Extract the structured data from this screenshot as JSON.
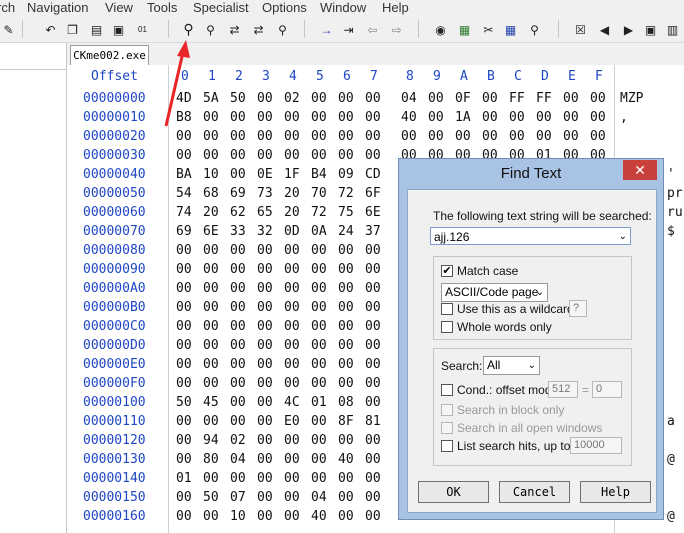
{
  "menu": [
    "rch",
    "Navigation",
    "View",
    "Tools",
    "Specialist",
    "Options",
    "Window",
    "Help"
  ],
  "tab": {
    "label": "CKme002.exe"
  },
  "header": {
    "offset_label": "Offset",
    "cols": [
      "0",
      "1",
      "2",
      "3",
      "4",
      "5",
      "6",
      "7",
      "8",
      "9",
      "A",
      "B",
      "C",
      "D",
      "E",
      "F"
    ]
  },
  "rows": [
    {
      "offset": "00000000",
      "bytes": [
        "4D",
        "5A",
        "50",
        "00",
        "02",
        "00",
        "00",
        "00",
        "04",
        "00",
        "0F",
        "00",
        "FF",
        "FF",
        "00",
        "00"
      ],
      "text": "MZP"
    },
    {
      "offset": "00000010",
      "bytes": [
        "B8",
        "00",
        "00",
        "00",
        "00",
        "00",
        "00",
        "00",
        "40",
        "00",
        "1A",
        "00",
        "00",
        "00",
        "00",
        "00"
      ],
      "text": ","
    },
    {
      "offset": "00000020",
      "bytes": [
        "00",
        "00",
        "00",
        "00",
        "00",
        "00",
        "00",
        "00",
        "00",
        "00",
        "00",
        "00",
        "00",
        "00",
        "00",
        "00"
      ],
      "text": ""
    },
    {
      "offset": "00000030",
      "bytes": [
        "00",
        "00",
        "00",
        "00",
        "00",
        "00",
        "00",
        "00",
        "00",
        "00",
        "00",
        "00",
        "00",
        "01",
        "00",
        "00"
      ],
      "text": ""
    },
    {
      "offset": "00000040",
      "bytes": [
        "BA",
        "10",
        "00",
        "0E",
        "1F",
        "B4",
        "09",
        "CD",
        "",
        "",
        "",
        "",
        "",
        "",
        "",
        ""
      ],
      "text": "'"
    },
    {
      "offset": "00000050",
      "bytes": [
        "54",
        "68",
        "69",
        "73",
        "20",
        "70",
        "72",
        "6F",
        "",
        "",
        "",
        "",
        "",
        "",
        "",
        ""
      ],
      "text": "pr"
    },
    {
      "offset": "00000060",
      "bytes": [
        "74",
        "20",
        "62",
        "65",
        "20",
        "72",
        "75",
        "6E",
        "",
        "",
        "",
        "",
        "",
        "",
        "",
        ""
      ],
      "text": "ru"
    },
    {
      "offset": "00000070",
      "bytes": [
        "69",
        "6E",
        "33",
        "32",
        "0D",
        "0A",
        "24",
        "37",
        "",
        "",
        "",
        "",
        "",
        "",
        "",
        ""
      ],
      "text": "$"
    },
    {
      "offset": "00000080",
      "bytes": [
        "00",
        "00",
        "00",
        "00",
        "00",
        "00",
        "00",
        "00",
        "",
        "",
        "",
        "",
        "",
        "",
        "",
        ""
      ],
      "text": ""
    },
    {
      "offset": "00000090",
      "bytes": [
        "00",
        "00",
        "00",
        "00",
        "00",
        "00",
        "00",
        "00",
        "",
        "",
        "",
        "",
        "",
        "",
        "",
        ""
      ],
      "text": ""
    },
    {
      "offset": "000000A0",
      "bytes": [
        "00",
        "00",
        "00",
        "00",
        "00",
        "00",
        "00",
        "00",
        "",
        "",
        "",
        "",
        "",
        "",
        "",
        ""
      ],
      "text": ""
    },
    {
      "offset": "000000B0",
      "bytes": [
        "00",
        "00",
        "00",
        "00",
        "00",
        "00",
        "00",
        "00",
        "",
        "",
        "",
        "",
        "",
        "",
        "",
        ""
      ],
      "text": ""
    },
    {
      "offset": "000000C0",
      "bytes": [
        "00",
        "00",
        "00",
        "00",
        "00",
        "00",
        "00",
        "00",
        "",
        "",
        "",
        "",
        "",
        "",
        "",
        ""
      ],
      "text": ""
    },
    {
      "offset": "000000D0",
      "bytes": [
        "00",
        "00",
        "00",
        "00",
        "00",
        "00",
        "00",
        "00",
        "",
        "",
        "",
        "",
        "",
        "",
        "",
        ""
      ],
      "text": ""
    },
    {
      "offset": "000000E0",
      "bytes": [
        "00",
        "00",
        "00",
        "00",
        "00",
        "00",
        "00",
        "00",
        "",
        "",
        "",
        "",
        "",
        "",
        "",
        ""
      ],
      "text": ""
    },
    {
      "offset": "000000F0",
      "bytes": [
        "00",
        "00",
        "00",
        "00",
        "00",
        "00",
        "00",
        "00",
        "",
        "",
        "",
        "",
        "",
        "",
        "",
        ""
      ],
      "text": ""
    },
    {
      "offset": "00000100",
      "bytes": [
        "50",
        "45",
        "00",
        "00",
        "4C",
        "01",
        "08",
        "00",
        "",
        "",
        "",
        "",
        "",
        "",
        "",
        ""
      ],
      "text": ""
    },
    {
      "offset": "00000110",
      "bytes": [
        "00",
        "00",
        "00",
        "00",
        "E0",
        "00",
        "8F",
        "81",
        "",
        "",
        "",
        "",
        "",
        "",
        "",
        ""
      ],
      "text": "a"
    },
    {
      "offset": "00000120",
      "bytes": [
        "00",
        "94",
        "02",
        "00",
        "00",
        "00",
        "00",
        "00",
        "",
        "",
        "",
        "",
        "",
        "",
        "",
        ""
      ],
      "text": ""
    },
    {
      "offset": "00000130",
      "bytes": [
        "00",
        "80",
        "04",
        "00",
        "00",
        "00",
        "40",
        "00",
        "",
        "",
        "",
        "",
        "",
        "",
        "",
        ""
      ],
      "text": "@"
    },
    {
      "offset": "00000140",
      "bytes": [
        "01",
        "00",
        "00",
        "00",
        "00",
        "00",
        "00",
        "00",
        "",
        "",
        "",
        "",
        "",
        "",
        "",
        ""
      ],
      "text": ""
    },
    {
      "offset": "00000150",
      "bytes": [
        "00",
        "50",
        "07",
        "00",
        "00",
        "04",
        "00",
        "00",
        "",
        "",
        "",
        "",
        "",
        "",
        "",
        ""
      ],
      "text": ""
    },
    {
      "offset": "00000160",
      "bytes": [
        "00",
        "00",
        "10",
        "00",
        "00",
        "40",
        "00",
        "00",
        "",
        "",
        "",
        "",
        "",
        "",
        "",
        ""
      ],
      "text": "@"
    }
  ],
  "dialog": {
    "title": "Find Text",
    "close": "✕",
    "prompt": "The following text string will be searched:",
    "search_value": "ajj.126",
    "match_case": "Match case",
    "encoding": "ASCII/Code page",
    "wildcard": "Use this as a wildcard:",
    "wildcard_char": "?",
    "whole_words": "Whole words only",
    "search_label": "Search:",
    "search_scope": "All",
    "cond_label": "Cond.: offset mod",
    "cond_mod": "512",
    "cond_eq": "=",
    "cond_val": "0",
    "block_only": "Search in block only",
    "all_windows": "Search in all open windows",
    "list_hits": "List search hits, up to",
    "list_max": "10000",
    "ok": "OK",
    "cancel": "Cancel",
    "help": "Help"
  }
}
